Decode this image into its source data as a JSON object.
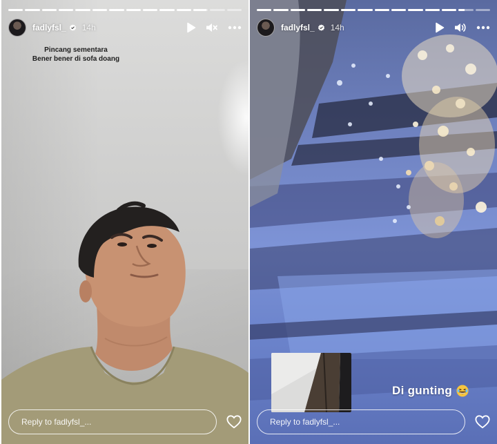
{
  "stories": [
    {
      "username": "fadlyfsl_",
      "timestamp": "14h",
      "caption_lines": [
        "Pincang sementara",
        "Bener bener di sofa doang"
      ],
      "reply_placeholder": "Reply to fadlyfsl_...",
      "progress": [
        1,
        1,
        1,
        1,
        1,
        1,
        1,
        1,
        1,
        1,
        1,
        0.9,
        0,
        0
      ],
      "sound": "muted"
    },
    {
      "username": "fadlyfsl_",
      "timestamp": "14h",
      "sticker_text": "Di gunting",
      "reply_placeholder": "Reply to fadlyfsl_...",
      "progress": [
        1,
        1,
        1,
        1,
        1,
        1,
        1,
        1,
        1,
        1,
        1,
        1,
        0.4,
        0
      ],
      "sound": "on"
    }
  ],
  "icons": {
    "play": "play-icon",
    "mute": "speaker-muted-icon",
    "sound": "speaker-icon",
    "more": "more-horizontal-icon",
    "like": "heart-outline-icon",
    "verified": "verified-badge-icon",
    "emoji": "laughing-emoji-icon"
  },
  "colors": {
    "overlay_text": "#ffffff",
    "caption_text": "#1e1e1e",
    "verified_badge": "#ffffff"
  }
}
